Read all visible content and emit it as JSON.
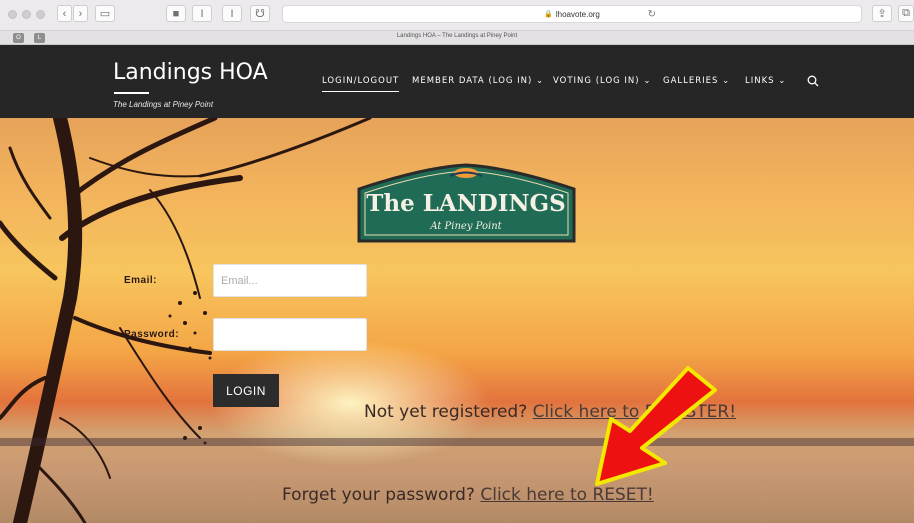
{
  "browser": {
    "url": "lhoavote.org",
    "tab_title": "Landings HOA – The Landings at Piney Point",
    "fav1": "O",
    "fav2": "L"
  },
  "header": {
    "title": "Landings HOA",
    "tagline": "The Landings at Piney Point",
    "nav": [
      {
        "label": "LOGIN/LOGOUT"
      },
      {
        "label": "MEMBER DATA (LOG IN) ⌄"
      },
      {
        "label": "VOTING (LOG IN) ⌄"
      },
      {
        "label": "GALLERIES ⌄"
      },
      {
        "label": "LINKS ⌄"
      }
    ]
  },
  "sign": {
    "line1": "The LANDINGS",
    "line2": "At Piney Point"
  },
  "form": {
    "email_label": "Email:",
    "email_placeholder": "Email...",
    "password_label": "Password:",
    "login_label": "LOGIN"
  },
  "register": {
    "prefix": "Not yet registered? ",
    "link": "Click here to REGISTER!"
  },
  "reset": {
    "prefix": "Forget your password? ",
    "link": "Click here to RESET!"
  },
  "colors": {
    "header_bg": "#262626",
    "arrow_fill": "#ee1111",
    "arrow_outline": "#f5e800",
    "sign_green": "#1f6b55"
  }
}
